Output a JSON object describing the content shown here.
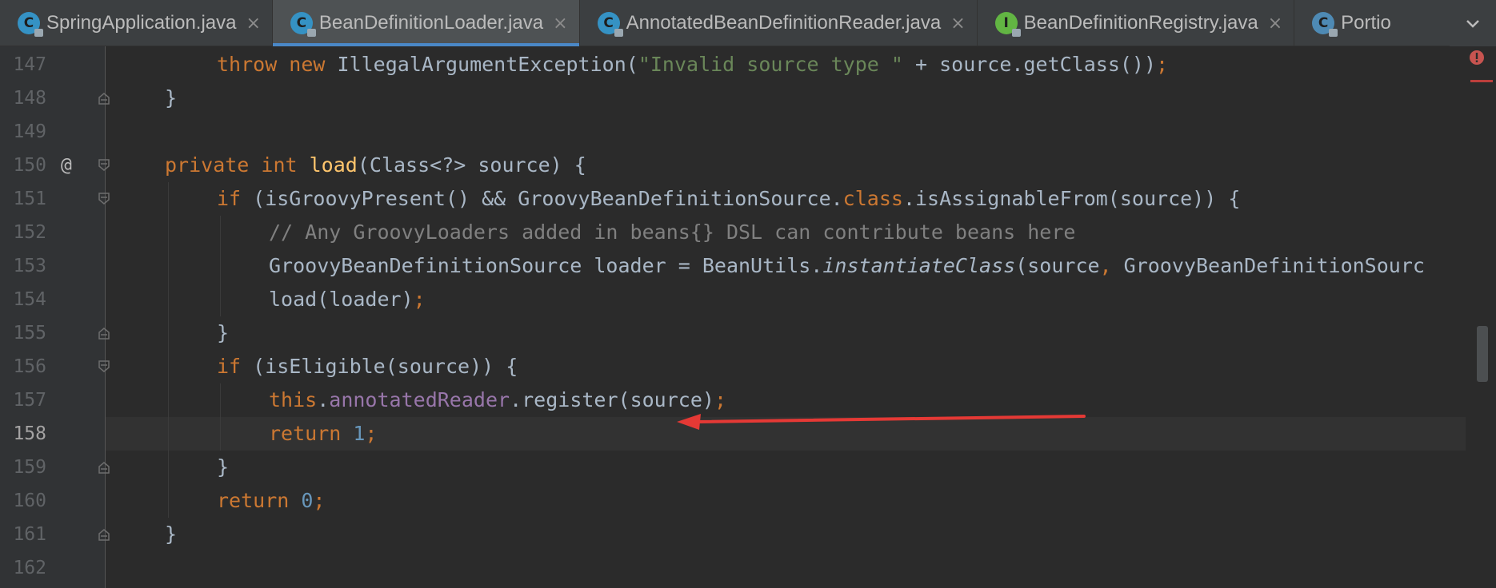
{
  "tabs": [
    {
      "label": "SpringApplication.java",
      "icon": "class-icon",
      "active": false
    },
    {
      "label": "BeanDefinitionLoader.java",
      "icon": "class-icon",
      "active": true
    },
    {
      "label": "AnnotatedBeanDefinitionReader.java",
      "icon": "class-icon",
      "active": false
    },
    {
      "label": "BeanDefinitionRegistry.java",
      "icon": "interface-icon",
      "active": false
    },
    {
      "label": "Portio",
      "icon": "class-icon",
      "active": false
    }
  ],
  "icon_letters": {
    "class": "C",
    "interface": "I"
  },
  "close_glyph": "×",
  "gutter": {
    "line_numbers": [
      "147",
      "148",
      "149",
      "150",
      "151",
      "152",
      "153",
      "154",
      "155",
      "156",
      "157",
      "158",
      "159",
      "160",
      "161",
      "162"
    ],
    "current_line": "158",
    "override_marker": "@"
  },
  "code": {
    "l147": {
      "t1": "throw new ",
      "t2": "IllegalArgumentException(",
      "t3": "\"Invalid source type \"",
      "t4": " + source.getClass())",
      "t5": ";"
    },
    "l148": {
      "t1": "}"
    },
    "l150": {
      "t1": "private int ",
      "t2": "load",
      "t3": "(Class<?> source) {"
    },
    "l151": {
      "t1": "if ",
      "t2": "(isGroovyPresent() && GroovyBeanDefinitionSource.",
      "t3": "class",
      "t4": ".isAssignableFrom(source)) {"
    },
    "l152": {
      "t1": "// Any GroovyLoaders added in beans{} DSL can contribute beans here"
    },
    "l153": {
      "t1": "GroovyBeanDefinitionSource loader = BeanUtils.",
      "t2": "instantiateClass",
      "t3": "(source",
      "t4": ", ",
      "t5": "GroovyBeanDefinitionSourc"
    },
    "l154": {
      "t1": "load(loader)",
      "t2": ";"
    },
    "l155": {
      "t1": "}"
    },
    "l156": {
      "t1": "if ",
      "t2": "(isEligible(source)) {"
    },
    "l157": {
      "t1": "this",
      "t2": ".",
      "t3": "annotatedReader",
      "t4": ".register(source)",
      "t5": ";"
    },
    "l158": {
      "t1": "return ",
      "t2": "1",
      "t3": ";"
    },
    "l159": {
      "t1": "}"
    },
    "l160": {
      "t1": "return ",
      "t2": "0",
      "t3": ";"
    },
    "l161": {
      "t1": "}"
    }
  },
  "colors": {
    "keyword": "#cc7832",
    "string": "#6a8759",
    "number": "#6897bb",
    "comment": "#808080",
    "method_decl": "#ffc66d",
    "field": "#9876aa",
    "annotation_arrow": "#e53935"
  }
}
